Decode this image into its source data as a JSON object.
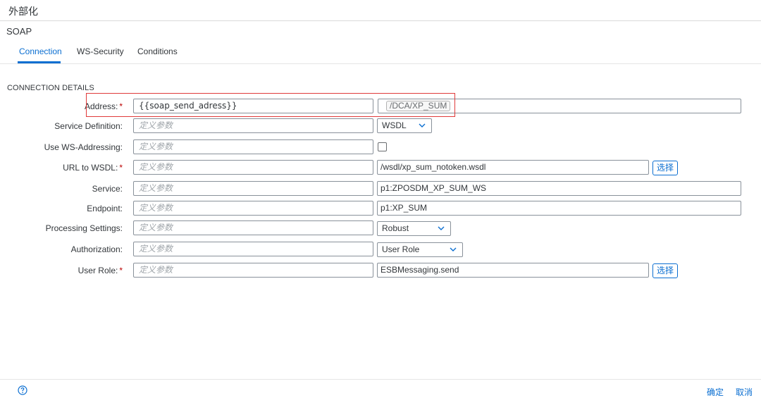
{
  "window": {
    "title": "外部化"
  },
  "adapter": {
    "type": "SOAP"
  },
  "tabs": [
    {
      "label": "Connection",
      "active": true
    },
    {
      "label": "WS-Security",
      "active": false
    },
    {
      "label": "Conditions",
      "active": false
    }
  ],
  "section": {
    "title": "CONNECTION DETAILS"
  },
  "placeholder": "定义参数",
  "fields": {
    "address": {
      "label": "Address:",
      "required": true,
      "param": "{{soap_send_adress}}",
      "value": "/DCA/XP_SUM"
    },
    "service_definition": {
      "label": "Service Definition:",
      "required": false,
      "value": "WSDL"
    },
    "use_ws_addressing": {
      "label": "Use WS-Addressing:",
      "required": false,
      "checked": false
    },
    "url_to_wsdl": {
      "label": "URL to WSDL:",
      "required": true,
      "value": "/wsdl/xp_sum_notoken.wsdl",
      "button": "选择"
    },
    "service": {
      "label": "Service:",
      "required": false,
      "value": "p1:ZPOSDM_XP_SUM_WS"
    },
    "endpoint": {
      "label": "Endpoint:",
      "required": false,
      "value": "p1:XP_SUM"
    },
    "processing_settings": {
      "label": "Processing Settings:",
      "required": false,
      "value": "Robust"
    },
    "authorization": {
      "label": "Authorization:",
      "required": false,
      "value": "User Role"
    },
    "user_role": {
      "label": "User Role:",
      "required": true,
      "value": "ESBMessaging.send",
      "button": "选择"
    }
  },
  "required_marker": "*",
  "footer": {
    "ok": "确定",
    "cancel": "取消"
  },
  "colors": {
    "accent": "#0a6ed1",
    "required": "#bb0000",
    "highlight": "#e03a3a"
  },
  "icons": {
    "help": "question-circle-icon",
    "dropdown": "chevron-down-icon"
  }
}
